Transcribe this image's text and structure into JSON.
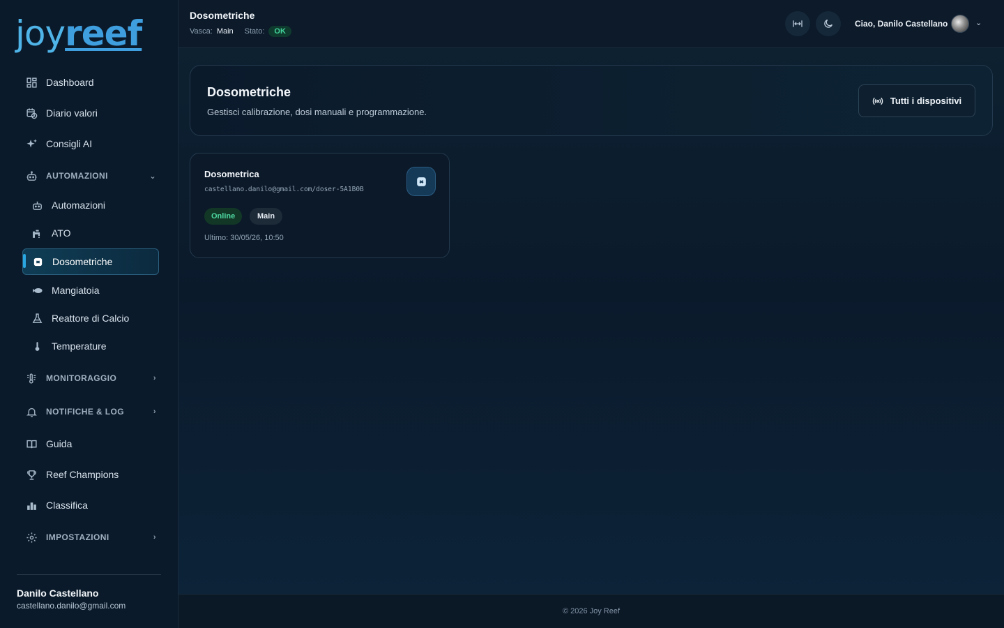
{
  "brand": {
    "part1": "joy",
    "part2": "reef"
  },
  "sidebar": {
    "items": [
      {
        "label": "Dashboard",
        "icon": "dashboard-icon"
      },
      {
        "label": "Diario valori",
        "icon": "calendar-clock-icon"
      },
      {
        "label": "Consigli AI",
        "icon": "sparkles-icon"
      }
    ],
    "groups": {
      "automazioni": "AUTOMAZIONI",
      "monitoraggio": "MONITORAGGIO",
      "notifiche": "NOTIFICHE & LOG",
      "impostazioni": "IMPOSTAZIONI"
    },
    "automazioni_items": [
      {
        "label": "Automazioni",
        "icon": "robot-icon"
      },
      {
        "label": "ATO",
        "icon": "faucet-icon"
      },
      {
        "label": "Dosometriche",
        "icon": "doser-icon",
        "active": true
      },
      {
        "label": "Mangiatoia",
        "icon": "fish-icon"
      },
      {
        "label": "Reattore di Calcio",
        "icon": "flask-icon"
      },
      {
        "label": "Temperature",
        "icon": "thermometer-icon"
      }
    ],
    "bottom_items": [
      {
        "label": "Guida",
        "icon": "book-icon"
      },
      {
        "label": "Reef Champions",
        "icon": "trophy-icon"
      },
      {
        "label": "Classifica",
        "icon": "leaderboard-icon"
      }
    ],
    "user": {
      "name": "Danilo Castellano",
      "email": "castellano.danilo@gmail.com"
    }
  },
  "header": {
    "title": "Dosometriche",
    "vasca_label": "Vasca:",
    "vasca_value": "Main",
    "stato_label": "Stato:",
    "stato_value": "OK",
    "greeting": "Ciao, Danilo Castellano"
  },
  "hero": {
    "title": "Dosometriche",
    "subtitle": "Gestisci calibrazione, dosi manuali e programmazione.",
    "button_label": "Tutti i dispositivi"
  },
  "device": {
    "name": "Dosometrica",
    "id": "castellano.danilo@gmail.com/doser-5A1B0B",
    "status": "Online",
    "tank": "Main",
    "last_seen": "Ultimo: 30/05/26, 10:50"
  },
  "footer": {
    "text": "© 2026 Joy Reef"
  },
  "colors": {
    "accent": "#2aa7e0",
    "ok": "#42d49b",
    "background": "#0a1626"
  }
}
